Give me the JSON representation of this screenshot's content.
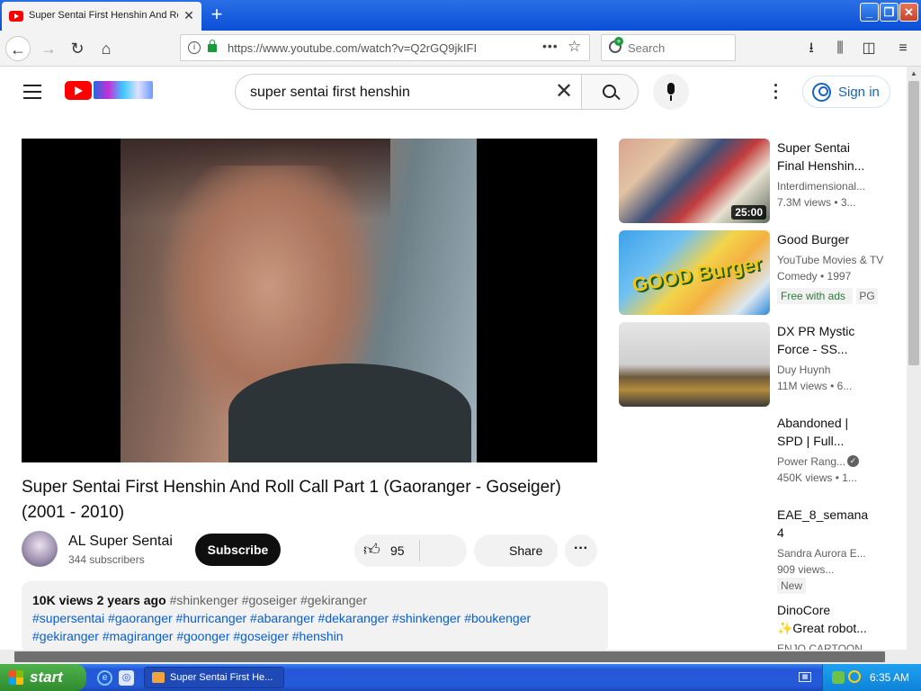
{
  "browser": {
    "tab_title": "Super Sentai First Henshin And Roll",
    "tab_close": "✕",
    "new_tab": "+",
    "url": "https://www.youtube.com/watch?v=Q2rGQ9jkIFI",
    "url_dots": "•••",
    "search_placeholder": "Search",
    "window_buttons": {
      "minimize": "_",
      "restore": "❐",
      "close": "✕"
    }
  },
  "youtube": {
    "search_query": "super sentai first henshin",
    "signin_label": "Sign in",
    "video": {
      "title": "Super Sentai First Henshin And Roll Call Part 1 (Gaoranger - Goseiger) (2001 - 2010)",
      "channel_name": "AL Super Sentai",
      "subscribers": "344 subscribers",
      "subscribe_label": "Subscribe",
      "likes": "95",
      "share_label": "Share",
      "views": "10K views",
      "age": "2 years ago",
      "meta_tags": "#shinkenger #goseiger #gekiranger",
      "tags_line1": "#supersentai #gaoranger #hurricanger #abaranger #dekaranger #shinkenger #boukenger",
      "tags_line2": "#gekiranger #magiranger #goonger #goseiger #henshin"
    },
    "recommendations": [
      {
        "title_l1": "Super Sentai",
        "title_l2": "Final Henshin...",
        "channel": "Interdimensional...",
        "stats": "7.3M views • 3...",
        "duration": "25:00"
      },
      {
        "title_l1": "Good Burger",
        "channel": "YouTube Movies & TV",
        "stats": "Comedy • 1997",
        "badge_free": "Free with ads",
        "badge_rating": "PG",
        "thumb_text": "GOOD Burger"
      },
      {
        "title_l1": "DX PR Mystic",
        "title_l2": "Force - SS...",
        "channel": "Duy Huynh",
        "stats": "11M views • 6..."
      },
      {
        "title_l1": "Abandoned |",
        "title_l2": "SPD | Full...",
        "channel": "Power Rang...",
        "stats": "450K views • 1..."
      },
      {
        "title_l1": "EAE_8_semana",
        "title_l2": "4",
        "channel": "Sandra Aurora E...",
        "stats": "909 views...",
        "badge_new": "New"
      },
      {
        "title_l1": "DinoCore",
        "title_l2": "✨Great robot...",
        "channel": "ENJO CARTOON..."
      }
    ]
  },
  "taskbar": {
    "start_label": "start",
    "task_label": "Super Sentai First He...",
    "clock": "6:35 AM"
  }
}
